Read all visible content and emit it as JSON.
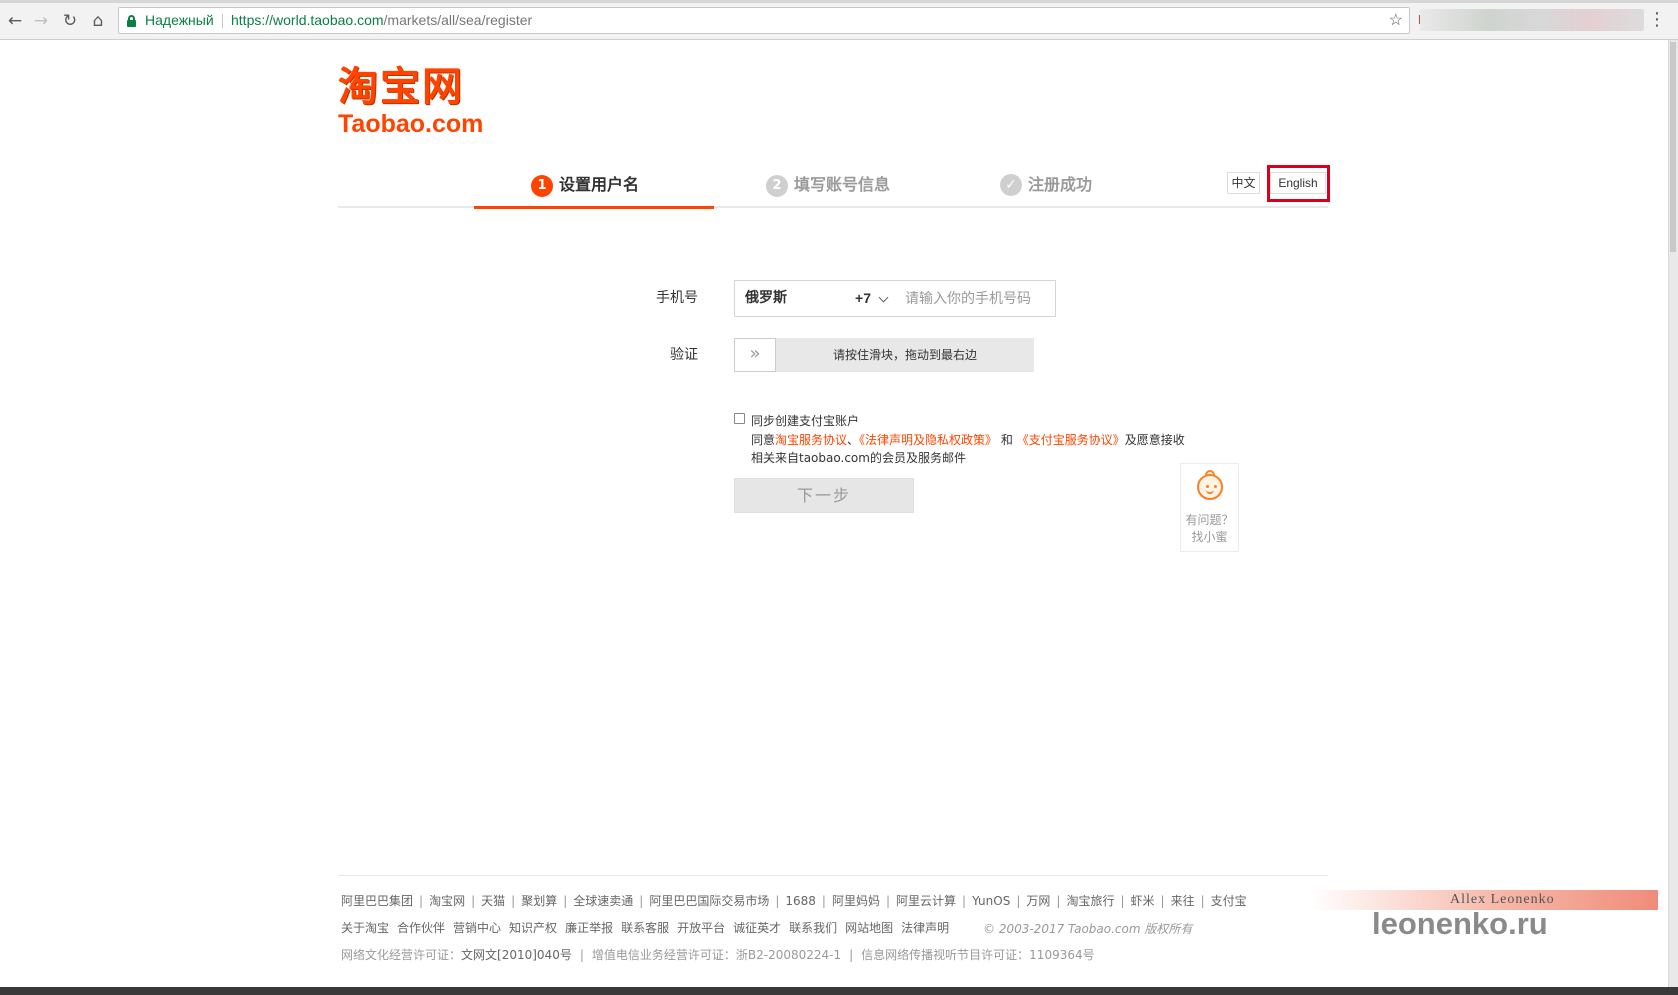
{
  "browser": {
    "back_icon": "←",
    "forward_icon": "→",
    "reload_icon": "↻",
    "home_icon": "⌂",
    "secure_label": "Надежный",
    "url_scheme": "https://",
    "url_host": "world.taobao.com",
    "url_path": "/markets/all/sea/register",
    "star_icon": "☆",
    "menu_icon": "⋮"
  },
  "header": {
    "logo_cn": "淘宝网",
    "logo_en": "Taobao.com",
    "steps": [
      {
        "num": "1",
        "label": "设置用户名"
      },
      {
        "num": "2",
        "label": "填写账号信息"
      },
      {
        "num": "✓",
        "label": "注册成功"
      }
    ],
    "lang_cn": "中文",
    "lang_en": "English"
  },
  "form": {
    "phone_label": "手机号",
    "country": "俄罗斯",
    "country_code": "+7",
    "phone_placeholder": "请输入你的手机号码",
    "verify_label": "验证",
    "slider_handle": "»",
    "slider_text": "请按住滑块，拖动到最右边",
    "alipay_checkbox_label": "同步创建支付宝账户",
    "agree_prefix": "同意",
    "agree_link1": "淘宝服务协议",
    "agree_sep": "、",
    "agree_link2": "《法律声明及隐私权政策》",
    "agree_and": " 和 ",
    "agree_link3": "《支付宝服务协议》",
    "agree_suffix": "及愿意接收",
    "agree_line2": "相关来自taobao.com的会员及服务邮件",
    "next_button": "下一步"
  },
  "help": {
    "line1": "有问题？",
    "line2": "找小蜜"
  },
  "footer": {
    "links_row1": [
      "阿里巴巴集团",
      "淘宝网",
      "天猫",
      "聚划算",
      "全球速卖通",
      "阿里巴巴国际交易市场",
      "1688",
      "阿里妈妈",
      "阿里云计算",
      "YunOS",
      "万网",
      "淘宝旅行",
      "虾米",
      "来往",
      "支付宝"
    ],
    "links_row2": [
      "关于淘宝",
      "合作伙伴",
      "营销中心",
      "知识产权",
      "廉正举报",
      "联系客服",
      "开放平台",
      "诚征英才",
      "联系我们",
      "网站地图",
      "法律声明"
    ],
    "copyright": "© 2003-2017 Taobao.com 版权所有",
    "license1_label": "网络文化经营许可证：",
    "license1_value": "文网文[2010]040号",
    "license2": "增值电信业务经营许可证：浙B2-20080224-1",
    "license3": "信息网络传播视听节目许可证：1109364号"
  },
  "watermark": {
    "author": "Allex Leonenko",
    "site": "leonenko.ru"
  },
  "colors": {
    "brand": "#ff4400",
    "secure_green": "#0b8043",
    "highlight_red": "#d9001b"
  }
}
